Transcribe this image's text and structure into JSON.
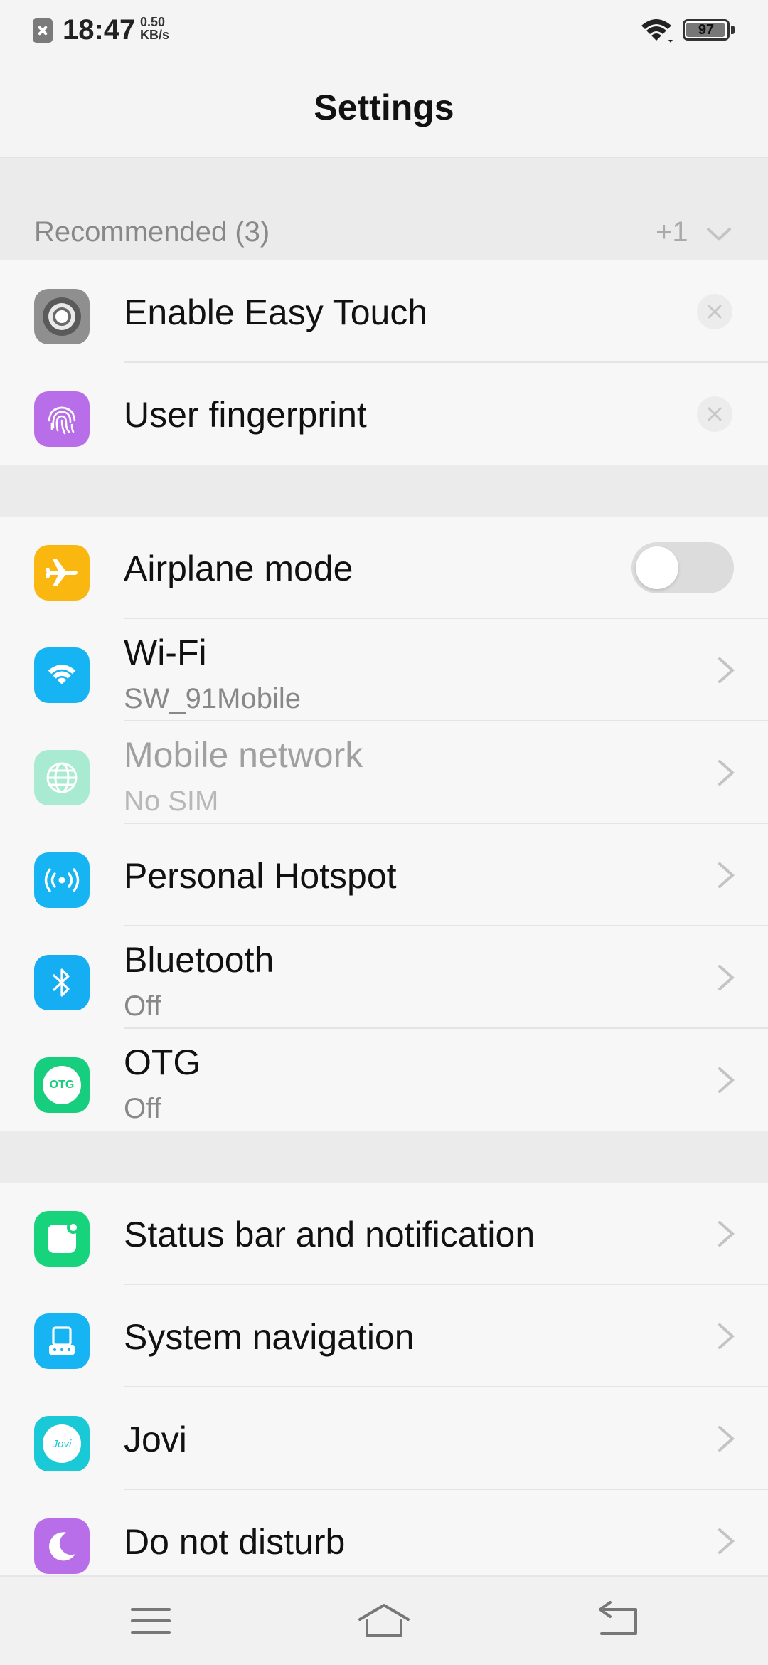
{
  "status_bar": {
    "time": "18:47",
    "net_speed_value": "0.50",
    "net_speed_unit": "KB/s",
    "battery_level": "97",
    "battery_fraction": 0.97,
    "icons": [
      "notification-blocked-icon",
      "wifi-icon",
      "battery-icon"
    ]
  },
  "header": {
    "title": "Settings"
  },
  "recommended": {
    "title": "Recommended (3)",
    "more": "+1",
    "items": [
      {
        "label": "Enable Easy Touch",
        "icon": "easy-touch-icon",
        "color": "#8f8f8f"
      },
      {
        "label": "User fingerprint",
        "icon": "fingerprint-icon",
        "color": "#b86ee8"
      }
    ]
  },
  "connectivity": {
    "items": [
      {
        "label": "Airplane mode",
        "sub": "",
        "icon": "airplane-icon",
        "color": "#f9b70f",
        "toggle": false
      },
      {
        "label": "Wi-Fi",
        "sub": "SW_91Mobile",
        "icon": "wifi-icon",
        "color": "#16b4f2"
      },
      {
        "label": "Mobile network",
        "sub": "No SIM",
        "icon": "globe-icon",
        "color": "#a8ebd2",
        "disabled": true
      },
      {
        "label": "Personal Hotspot",
        "sub": "",
        "icon": "hotspot-icon",
        "color": "#16b4f2"
      },
      {
        "label": "Bluetooth",
        "sub": "Off",
        "icon": "bluetooth-icon",
        "color": "#16aef2"
      },
      {
        "label": "OTG",
        "sub": "Off",
        "icon": "otg-icon",
        "color": "#17cd7e",
        "icon_text": "OTG"
      }
    ]
  },
  "system": {
    "items": [
      {
        "label": "Status bar and notification",
        "icon": "status-bar-icon",
        "color": "#17d37c"
      },
      {
        "label": "System navigation",
        "icon": "system-navigation-icon",
        "color": "#16b4f2"
      },
      {
        "label": "Jovi",
        "icon": "jovi-icon",
        "color": "#1ac9d6",
        "icon_text": "Jovi"
      },
      {
        "label": "Do not disturb",
        "icon": "moon-icon",
        "color": "#b86ee8"
      }
    ]
  },
  "nav_bar": {
    "icons": [
      "menu-icon",
      "home-icon",
      "back-icon"
    ]
  }
}
